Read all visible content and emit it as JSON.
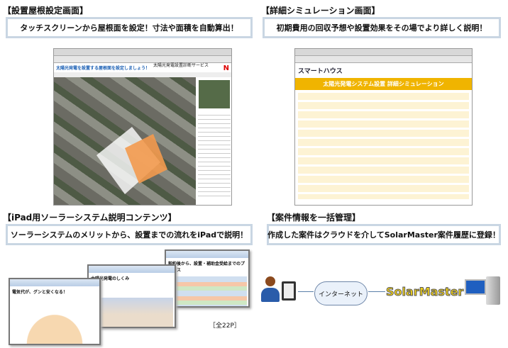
{
  "panels": [
    {
      "heading": "【設置屋根設定画面】",
      "caption": "タッチスクリーンから屋根面を設定！寸法や面積を自動算出！"
    },
    {
      "heading": "【詳細シミュレーション画面】",
      "caption": "初期費用の回収予想や設置効果をその場でより詳しく説明！"
    },
    {
      "heading": "【iPad用ソーラーシステム説明コンテンツ】",
      "caption": "ソーラーシステムのメリットから、設置までの流れをiPadで説明！"
    },
    {
      "heading": "【案件情報を一括管理】",
      "caption": "作成した案件はクラウドを介してSolarMaster案件履歴に登録！"
    }
  ],
  "roof_screen": {
    "title": "太陽光発電を設置する屋根面を設定しましょう！",
    "tab_right": "太陽光発電設置診断サービス",
    "north": "N"
  },
  "sim_screen": {
    "logo": "スマートハウス",
    "title": "太陽光発電システム設置 詳細シミュレーション"
  },
  "slides": {
    "s1": "電気代が、グンと安くなる！",
    "s2": "太陽光発電のしくみ",
    "s3": "契約後から、設置・補助金受給までのプロセス",
    "pages": "［全22P］"
  },
  "flow": {
    "cloud": "インターネット",
    "brand": "SolarMaster"
  },
  "colors": {
    "box_border": "#c9d6e3",
    "sim_accent": "#f0b400",
    "brand": "#f2d21a"
  }
}
